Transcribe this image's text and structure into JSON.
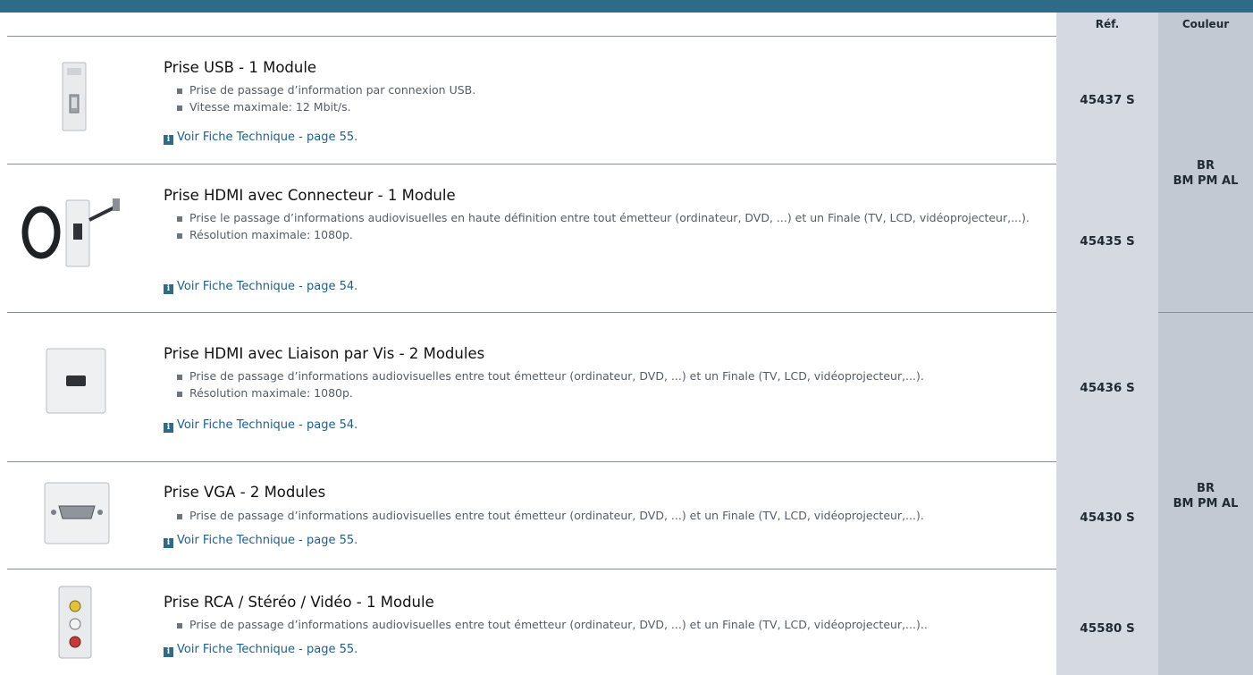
{
  "header": {
    "ref_label": "Réf.",
    "color_label": "Couleur"
  },
  "products": [
    {
      "title": "Prise USB - 1 Module",
      "bullets": [
        "Prise de passage d’information par connexion USB.",
        "Vitesse maximale: 12 Mbit/s."
      ],
      "link": "Voir Fiche Technique - page 55.",
      "ref": "45437 S",
      "icon": "usb-socket-icon"
    },
    {
      "title": "Prise HDMI avec Connecteur - 1 Module",
      "bullets": [
        "Prise le passage d’informations audiovisuelles en haute définition entre tout émetteur (ordinateur, DVD, ...) et un Finale  (TV, LCD, vidéoprojecteur,...).",
        "Résolution maximale: 1080p."
      ],
      "link": "Voir Fiche Technique - page 54.",
      "ref": "45435 S",
      "icon": "hdmi-cable-socket-icon"
    },
    {
      "title": "Prise HDMI avec Liaison par Vis - 2 Modules",
      "bullets": [
        "Prise de passage d’informations audiovisuelles entre tout émetteur (ordinateur, DVD, ...) et un Finale  (TV, LCD, vidéoprojecteur,...).",
        "Résolution maximale: 1080p."
      ],
      "link": "Voir Fiche Technique - page 54.",
      "ref": "45436 S",
      "icon": "hdmi-socket-icon"
    },
    {
      "title": "Prise VGA - 2 Modules",
      "bullets": [
        "Prise de passage d’informations audiovisuelles entre tout émetteur (ordinateur, DVD, ...) et un Finale  (TV, LCD, vidéoprojecteur,...)."
      ],
      "link": "Voir Fiche Technique - page 55.",
      "ref": "45430 S",
      "icon": "vga-socket-icon"
    },
    {
      "title": "Prise RCA / Stéréo / Vidéo - 1 Module",
      "bullets": [
        "Prise de passage d’informations audiovisuelles entre tout émetteur (ordinateur, DVD, ...) et un Finale  (TV, LCD, vidéoprojecteur,...).."
      ],
      "link": "Voir Fiche Technique - page 55.",
      "ref": "45580 S",
      "icon": "rca-socket-icon"
    }
  ],
  "colors": [
    {
      "line1": "BR",
      "line2": "BM PM AL"
    },
    {
      "line1": "BR",
      "line2": "BM PM AL"
    }
  ],
  "info_glyph": "i"
}
